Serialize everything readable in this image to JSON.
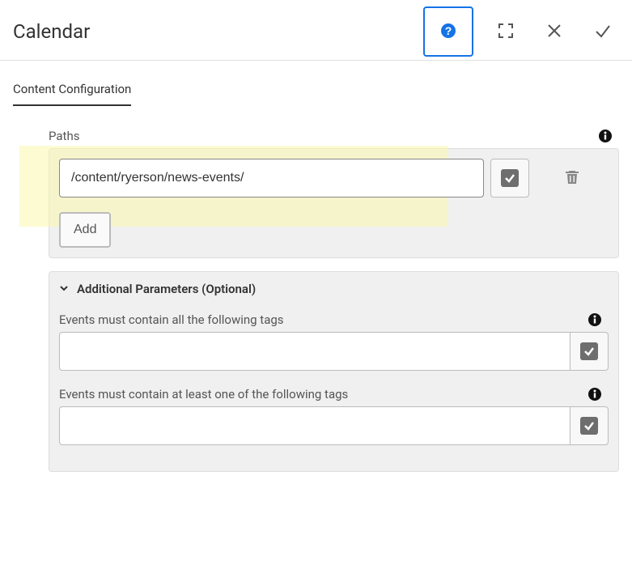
{
  "dialog": {
    "title": "Calendar"
  },
  "tabs": {
    "content_config": "Content Configuration"
  },
  "fields": {
    "paths": {
      "label": "Paths",
      "value": "/content/ryerson/news-events/",
      "addButton": "Add"
    },
    "accordion": {
      "title": "Additional Parameters (Optional)"
    },
    "allTags": {
      "label": "Events must contain all the following tags",
      "value": ""
    },
    "anyTags": {
      "label": "Events must contain at least one of the following tags",
      "value": ""
    }
  },
  "icons": {
    "help": "help-icon",
    "fullscreen": "fullscreen-icon",
    "close": "close-icon",
    "done": "done-icon",
    "info": "info-icon",
    "check": "check-icon",
    "trash": "trash-icon",
    "chevron": "chevron-down-icon"
  }
}
